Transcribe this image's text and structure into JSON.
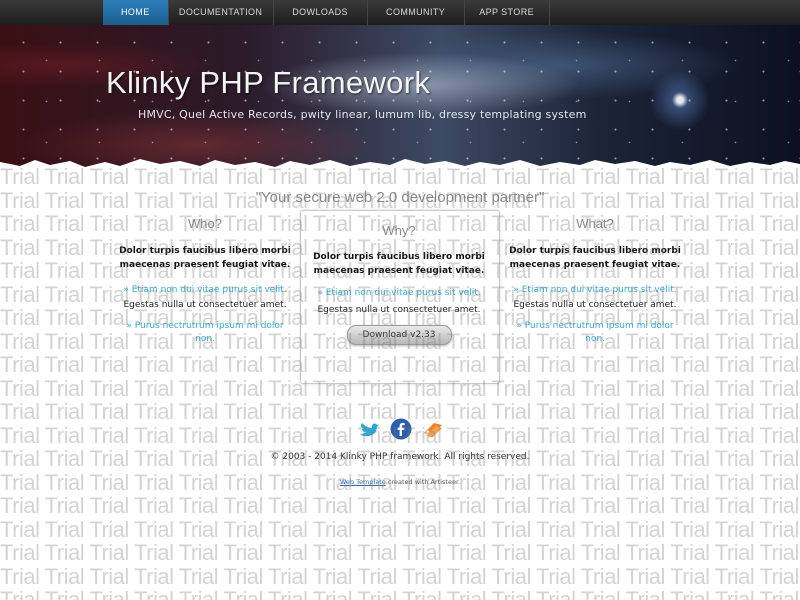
{
  "nav": {
    "items": [
      {
        "label": "HOME",
        "active": true
      },
      {
        "label": "DOCUMENTATION",
        "active": false
      },
      {
        "label": "DOWLOADS",
        "active": false
      },
      {
        "label": "COMMUNITY",
        "active": false
      },
      {
        "label": "APP STORE",
        "active": false
      }
    ]
  },
  "header": {
    "title": "Klinky PHP Framework",
    "subtitle": "HMVC, Quel Active Records, pwity linear, lumum lib, dressy templating system"
  },
  "slogan": "\"Your secure web 2.0 development partner\"",
  "columns": [
    {
      "heading": "Who?",
      "lead": "Dolor turpis faucibus libero morbi maecenas praesent feugiat vitae.",
      "item_a": "» Etiam non dui vitae purus sit velit.",
      "item_b": "Egestas nulla ut consectetuer amet.",
      "item_c": "» Purus nectrutrum ipsum mi dolor non."
    },
    {
      "heading": "Why?",
      "lead": "Dolor turpis faucibus libero morbi maecenas praesent feugiat vitae.",
      "item_a": "» Etiam non dui vitae purus sit velit.",
      "item_b": "Egestas nulla ut consectetuer amet.",
      "button": "Download v2.33"
    },
    {
      "heading": "What?",
      "lead": "Dolor turpis faucibus libero morbi maecenas praesent feugiat vitae.",
      "item_a": "» Etiam non dui vitae purus sit velit.",
      "item_b": "Egestas nulla ut consectetuer amet.",
      "item_c": "» Purus nectrutrum ipsum mi dolor non."
    }
  ],
  "social": [
    "twitter-icon",
    "facebook-icon",
    "rss-icon"
  ],
  "footer": {
    "copyright": "© 2003 - 2014 Klinky PHP framework. All rights reserved.",
    "credit_link": "Web Template",
    "credit_rest": " created with Artisteer."
  },
  "watermark": {
    "word": "Trial"
  },
  "colors": {
    "accent": "#2d7fb9",
    "link": "#3ea8d0",
    "nav_bg": "#2a2a2a"
  }
}
